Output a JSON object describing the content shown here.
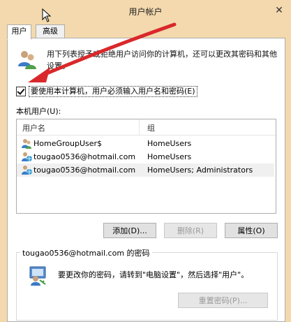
{
  "window": {
    "title": "用户帐户",
    "close_glyph": "✕"
  },
  "tabs": [
    {
      "label": "用户"
    },
    {
      "label": "高级"
    }
  ],
  "users_tab": {
    "description": "用下列表授予或拒绝用户访问你的计算机，还可以更改其密码和其他设置。",
    "require_login_label": "要使用本计算机，用户必须输入用户名和密码(E)",
    "require_login_checked": true,
    "list_label": "本机用户(U):",
    "columns": {
      "name": "用户名",
      "group": "组"
    },
    "users": [
      {
        "name": "HomeGroupUser$",
        "group": "HomeUsers",
        "icon": "user-icon"
      },
      {
        "name": "tougao0536@hotmail.com",
        "group": "HomeUsers",
        "icon": "user-globe-icon"
      },
      {
        "name": "tougao0536@hotmail.com",
        "group": "HomeUsers; Administrators",
        "icon": "user-globe-icon"
      }
    ],
    "buttons": {
      "add": "添加(D)...",
      "remove": "删除(R)",
      "properties": "属性(O)"
    },
    "password_group": {
      "title": "tougao0536@hotmail.com 的密码",
      "hint": "要更改你的密码，请转到\"电脑设置\"，然后选择\"用户\"。",
      "reset_button": "重置密码(P)..."
    }
  },
  "colors": {
    "window_frame": "#f3d9ad",
    "annotation_arrow": "#d9282b"
  }
}
